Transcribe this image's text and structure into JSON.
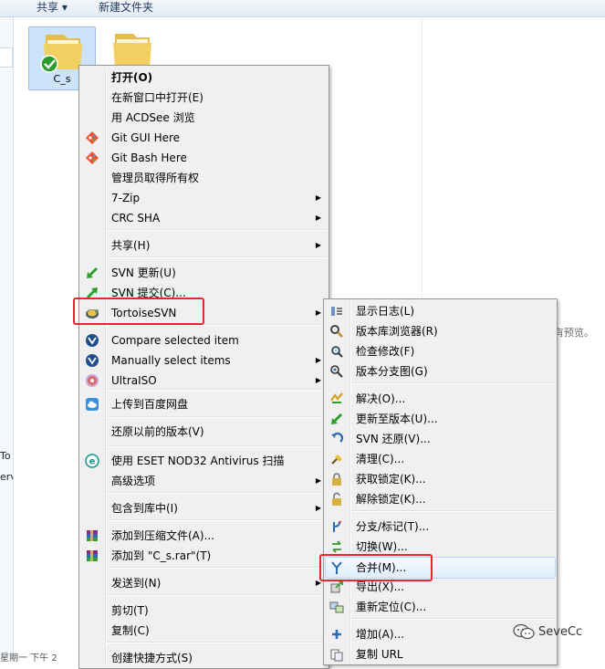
{
  "toolbar": {
    "share": "共享 ▾",
    "new_folder": "新建文件夹"
  },
  "files": [
    {
      "label": "C_s"
    },
    {
      "label": ""
    }
  ],
  "left_fragments": {
    "frag1": "To",
    "frag2": "erv"
  },
  "preview_text": "有预览。",
  "status_fragment": "星期一 下午 2",
  "watermark": {
    "text": "SeveCc"
  },
  "colors": {
    "menu_bg": "#f0f0f0",
    "highlight_border": "#e8262b",
    "hover_blue": "#e0eefc",
    "folder_yellow": "#f2cf61"
  },
  "main_menu": {
    "items": [
      {
        "label": "打开(O)",
        "icon": "none",
        "submenu": false
      },
      {
        "label": "在新窗口中打开(E)",
        "icon": "none",
        "submenu": false
      },
      {
        "label": "用 ACDSee 浏览",
        "icon": "none",
        "submenu": false
      },
      {
        "label": "Git GUI Here",
        "icon": "git-icon",
        "submenu": false
      },
      {
        "label": "Git Bash Here",
        "icon": "git-icon",
        "submenu": false
      },
      {
        "label": "管理员取得所有权",
        "icon": "none",
        "submenu": false
      },
      {
        "label": "7-Zip",
        "icon": "none",
        "submenu": true
      },
      {
        "label": "CRC SHA",
        "icon": "none",
        "submenu": true
      },
      {
        "label": "共享(H)",
        "icon": "none",
        "submenu": true
      },
      {
        "label": "SVN 更新(U)",
        "icon": "svn-update-icon",
        "submenu": false
      },
      {
        "label": "SVN 提交(C)...",
        "icon": "svn-commit-icon",
        "submenu": false
      },
      {
        "label": "TortoiseSVN",
        "icon": "tortoise-icon",
        "submenu": true
      },
      {
        "label": "Compare selected item",
        "icon": "compare-icon",
        "submenu": false
      },
      {
        "label": "Manually select items",
        "icon": "compare-icon",
        "submenu": true
      },
      {
        "label": "UltraISO",
        "icon": "disc-icon",
        "submenu": true
      },
      {
        "label": "上传到百度网盘",
        "icon": "cloud-icon",
        "submenu": false
      },
      {
        "label": "还原以前的版本(V)",
        "icon": "none",
        "submenu": false
      },
      {
        "label": "使用 ESET NOD32 Antivirus 扫描",
        "icon": "eset-icon",
        "submenu": false
      },
      {
        "label": "高级选项",
        "icon": "none",
        "submenu": true
      },
      {
        "label": "包含到库中(I)",
        "icon": "none",
        "submenu": true
      },
      {
        "label": "添加到压缩文件(A)...",
        "icon": "winrar-icon",
        "submenu": false
      },
      {
        "label": "添加到 \"C_s.rar\"(T)",
        "icon": "winrar-icon",
        "submenu": false
      },
      {
        "label": "发送到(N)",
        "icon": "none",
        "submenu": true
      },
      {
        "label": "剪切(T)",
        "icon": "none",
        "submenu": false
      },
      {
        "label": "复制(C)",
        "icon": "none",
        "submenu": false
      },
      {
        "label": "创建快捷方式(S)",
        "icon": "none",
        "submenu": false
      }
    ]
  },
  "svn_menu": {
    "items": [
      {
        "label": "显示日志(L)",
        "icon": "log-icon"
      },
      {
        "label": "版本库浏览器(R)",
        "icon": "repo-browser-icon"
      },
      {
        "label": "检查修改(F)",
        "icon": "check-modifications-icon"
      },
      {
        "label": "版本分支图(G)",
        "icon": "revision-graph-icon"
      },
      {
        "label": "解决(O)...",
        "icon": "resolve-icon"
      },
      {
        "label": "更新至版本(U)...",
        "icon": "update-to-revision-icon"
      },
      {
        "label": "SVN 还原(V)...",
        "icon": "revert-icon"
      },
      {
        "label": "清理(C)...",
        "icon": "cleanup-icon"
      },
      {
        "label": "获取锁定(K)...",
        "icon": "lock-icon"
      },
      {
        "label": "解除锁定(K)...",
        "icon": "unlock-icon"
      },
      {
        "label": "分支/标记(T)...",
        "icon": "branch-icon"
      },
      {
        "label": "切换(W)...",
        "icon": "switch-icon"
      },
      {
        "label": "合并(M)...",
        "icon": "merge-icon"
      },
      {
        "label": "导出(X)...",
        "icon": "export-icon"
      },
      {
        "label": "重新定位(C)...",
        "icon": "relocate-icon"
      },
      {
        "label": "增加(A)...",
        "icon": "add-icon"
      },
      {
        "label": "复制 URL",
        "icon": "copy-url-icon"
      }
    ]
  }
}
